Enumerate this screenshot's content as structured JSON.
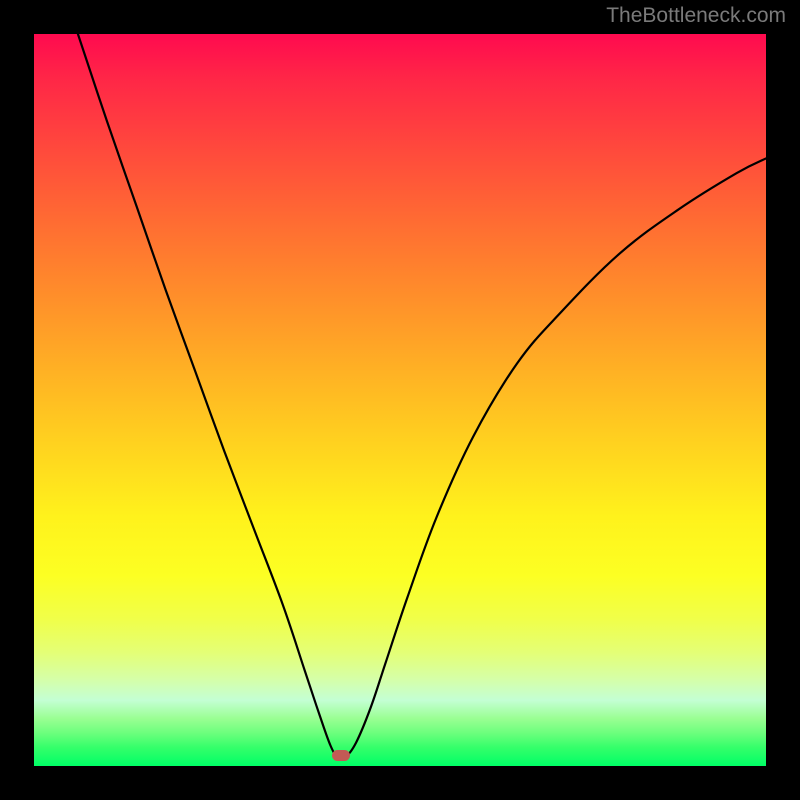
{
  "watermark": "TheBottleneck.com",
  "chart_data": {
    "type": "line",
    "title": "",
    "xlabel": "",
    "ylabel": "",
    "xlim": [
      0,
      100
    ],
    "ylim": [
      0,
      100
    ],
    "series": [
      {
        "name": "bottleneck-curve",
        "x": [
          6,
          10,
          14,
          18,
          22,
          26,
          30,
          34,
          37,
          39,
          40.5,
          41.5,
          42.5,
          44,
          46,
          48,
          51,
          55,
          60,
          66,
          72,
          80,
          88,
          96,
          100
        ],
        "values": [
          100,
          88,
          76.5,
          65,
          54,
          43,
          32.5,
          22,
          13,
          7,
          2.8,
          1.2,
          1.2,
          3.2,
          8,
          14,
          23,
          34,
          45,
          55,
          62,
          70,
          76,
          81,
          83
        ]
      }
    ],
    "marker": {
      "x": 42,
      "y": 1.5
    },
    "colors": {
      "curve": "#000000",
      "marker": "#c25a55",
      "gradient_top": "#ff0a4f",
      "gradient_mid": "#fff21c",
      "gradient_bottom": "#00ff66"
    }
  }
}
